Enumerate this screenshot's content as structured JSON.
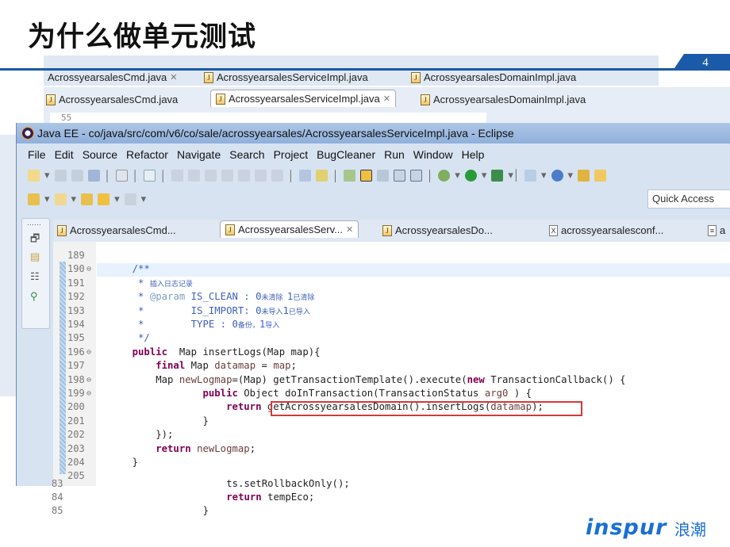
{
  "slide": {
    "title": "为什么做单元测试",
    "page_number": "4",
    "logo_text": "inspur",
    "logo_cn": "浪潮",
    "accent": "#1a5aa8"
  },
  "back_shot_1": {
    "tabs": [
      "AcrossyearsalesCmd.java",
      "AcrossyearsalesServiceImpl.java",
      "AcrossyearsalesDomainImpl.java"
    ]
  },
  "back_shot_2": {
    "tabs": [
      "AcrossyearsalesCmd.java",
      "AcrossyearsalesServiceImpl.java",
      "AcrossyearsalesDomainImpl.java"
    ],
    "line": "55"
  },
  "window": {
    "title": "Java EE - co/java/src/com/v6/co/sale/acrossyearsales/AcrossyearsalesServiceImpl.java - Eclipse",
    "menu": [
      "File",
      "Edit",
      "Source",
      "Refactor",
      "Navigate",
      "Search",
      "Project",
      "BugCleaner",
      "Run",
      "Window",
      "Help"
    ],
    "quick_access": "Quick Access",
    "editor_tabs": [
      {
        "label": "AcrossyearsalesCmd...",
        "icon": "java-file-icon"
      },
      {
        "label": "AcrossyearsalesServ...",
        "icon": "java-file-icon",
        "active": true
      },
      {
        "label": "AcrossyearsalesDo...",
        "icon": "java-file-icon"
      },
      {
        "label": "acrossyearsalesconf...",
        "icon": "xml-file-icon"
      },
      {
        "label": "a",
        "icon": "text-file-icon"
      }
    ],
    "code": [
      {
        "n": "189",
        "seg": []
      },
      {
        "n": "190",
        "fold": true,
        "seg": [
          [
            "cm",
            "    /**"
          ]
        ]
      },
      {
        "n": "191",
        "seg": [
          [
            "cm",
            "     * "
          ],
          [
            "cn",
            "插入日志记录"
          ]
        ]
      },
      {
        "n": "192",
        "seg": [
          [
            "cm",
            "     * "
          ],
          [
            "cmt",
            "@param"
          ],
          [
            "cm",
            " IS_CLEAN : 0"
          ],
          [
            "cn",
            "未清除 "
          ],
          [
            "cm",
            "1"
          ],
          [
            "cn",
            "已清除"
          ]
        ]
      },
      {
        "n": "193",
        "seg": [
          [
            "cm",
            "     *        IS_IMPORT: 0"
          ],
          [
            "cn",
            "未导入"
          ],
          [
            "cm",
            "1"
          ],
          [
            "cn",
            "已导入"
          ]
        ]
      },
      {
        "n": "194",
        "seg": [
          [
            "cm",
            "     *        TYPE : 0"
          ],
          [
            "cn",
            "备份，"
          ],
          [
            "cm",
            "1"
          ],
          [
            "cn",
            "导入"
          ]
        ]
      },
      {
        "n": "195",
        "seg": [
          [
            "cm",
            "     */"
          ]
        ]
      },
      {
        "n": "196",
        "fold": true,
        "seg": [
          [
            "kw",
            "    public"
          ],
          [
            "",
            "  Map insertLogs(Map map){"
          ]
        ]
      },
      {
        "n": "197",
        "seg": [
          [
            "kw",
            "        final"
          ],
          [
            "",
            " Map "
          ],
          [
            "var",
            "datamap"
          ],
          [
            "",
            " = "
          ],
          [
            "var",
            "map"
          ],
          [
            "",
            ";"
          ]
        ]
      },
      {
        "n": "198",
        "fold": true,
        "seg": [
          [
            "",
            "        Map "
          ],
          [
            "var",
            "newLogmap"
          ],
          [
            "",
            "=(Map) getTransactionTemplate().execute("
          ],
          [
            "kw",
            "new"
          ],
          [
            "",
            " TransactionCallback() {"
          ]
        ]
      },
      {
        "n": "199",
        "fold": true,
        "seg": [
          [
            "kw",
            "                public"
          ],
          [
            "",
            " Object doInTransaction(TransactionStatus "
          ],
          [
            "var",
            "arg0"
          ],
          [
            "",
            " ) {"
          ]
        ]
      },
      {
        "n": "200",
        "seg": [
          [
            "kw",
            "                    return"
          ],
          [
            "",
            " getAcrossyearsalesDomain().insertLogs("
          ],
          [
            "var",
            "datamap"
          ],
          [
            "",
            ");"
          ]
        ]
      },
      {
        "n": "201",
        "seg": [
          [
            "",
            "                }"
          ]
        ]
      },
      {
        "n": "202",
        "seg": [
          [
            "",
            "        });"
          ]
        ]
      },
      {
        "n": "203",
        "seg": [
          [
            "kw",
            "        return"
          ],
          [
            "",
            " "
          ],
          [
            "var",
            "newLogmap"
          ],
          [
            "",
            ";"
          ]
        ]
      },
      {
        "n": "204",
        "seg": [
          [
            "",
            "    }"
          ]
        ]
      },
      {
        "n": "205",
        "seg": []
      }
    ]
  },
  "bottom_shot": {
    "code": [
      {
        "n": "83",
        "seg": [
          [
            "",
            "                       ts.setRollbackOnly();"
          ]
        ]
      },
      {
        "n": "84",
        "seg": [
          [
            "kw",
            "                       return"
          ],
          [
            "",
            " tempEco;"
          ]
        ]
      },
      {
        "n": "85",
        "seg": [
          [
            "",
            "                   }"
          ]
        ]
      }
    ]
  }
}
